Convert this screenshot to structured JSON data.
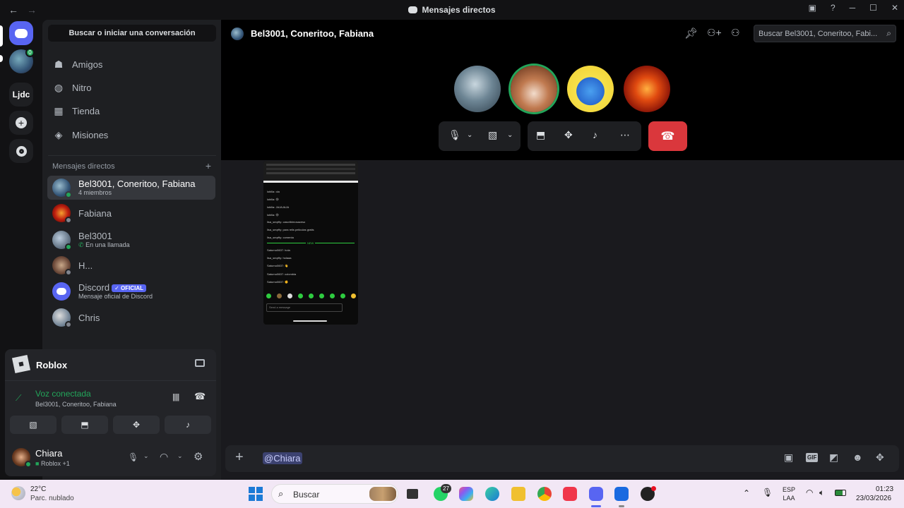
{
  "window": {
    "title": "Mensajes directos"
  },
  "servers": {
    "ljdc": "Ljdc",
    "notification_count": "0"
  },
  "sidebar": {
    "search_label": "Buscar o iniciar una conversación",
    "nav": [
      {
        "label": "Amigos",
        "icon": "friends-icon"
      },
      {
        "label": "Nitro",
        "icon": "nitro-icon"
      },
      {
        "label": "Tienda",
        "icon": "shop-icon"
      },
      {
        "label": "Misiones",
        "icon": "quests-icon"
      }
    ],
    "dm_header": "Mensajes directos",
    "dms": [
      {
        "name": "Bel3001, Coneritoo, Fabiana",
        "sub": "4 miembros"
      },
      {
        "name": "Fabiana",
        "sub": ""
      },
      {
        "name": "Bel3001",
        "sub": "En una llamada"
      },
      {
        "name": "H...",
        "sub": ""
      },
      {
        "name": "Discord",
        "badge": "✓ OFICIAL",
        "sub": "Mensaje oficial de Discord"
      },
      {
        "name": "Chris",
        "sub": ""
      }
    ],
    "activity": {
      "app": "Roblox"
    },
    "voice": {
      "status": "Voz conectada",
      "channel": "Bel3001, Coneritoo, Fabiana"
    },
    "user": {
      "name": "Chiara",
      "status": "Roblox +1"
    }
  },
  "chat": {
    "title": "Bel3001, Coneritoo, Fabiana",
    "search_placeholder": "Buscar Bel3001, Coneritoo, Fabi...",
    "composer_text": "@Chiara"
  },
  "shared_screen": {
    "lines": [
      "lobilla: ola",
      "lobilla: 😅",
      "lobilla: JAJAJAJA",
      "lobilla: 😅",
      "lisa_seqrfty: cascribimosaceso",
      "lisa_seqrfty: para relis peliculas gratis",
      "lisa_seqrfty: comenta",
      "NEW",
      "Saturno0607: hola",
      "lisa_seqrfty: holaaa",
      "Saturno0607: 👋",
      "Saturno0607: colombia",
      "Saturno0607: ✊"
    ],
    "send_placeholder": "Send a message"
  },
  "taskbar": {
    "weather_temp": "22°C",
    "weather_desc": "Parc. nublado",
    "search": "Buscar",
    "whatsapp_count": "27",
    "lang1": "ESP",
    "lang2": "LAA",
    "time": "01:23",
    "date": "23/03/2026"
  },
  "colors": {
    "accent": "#5865f2",
    "online": "#23a55a",
    "danger": "#da373c"
  }
}
